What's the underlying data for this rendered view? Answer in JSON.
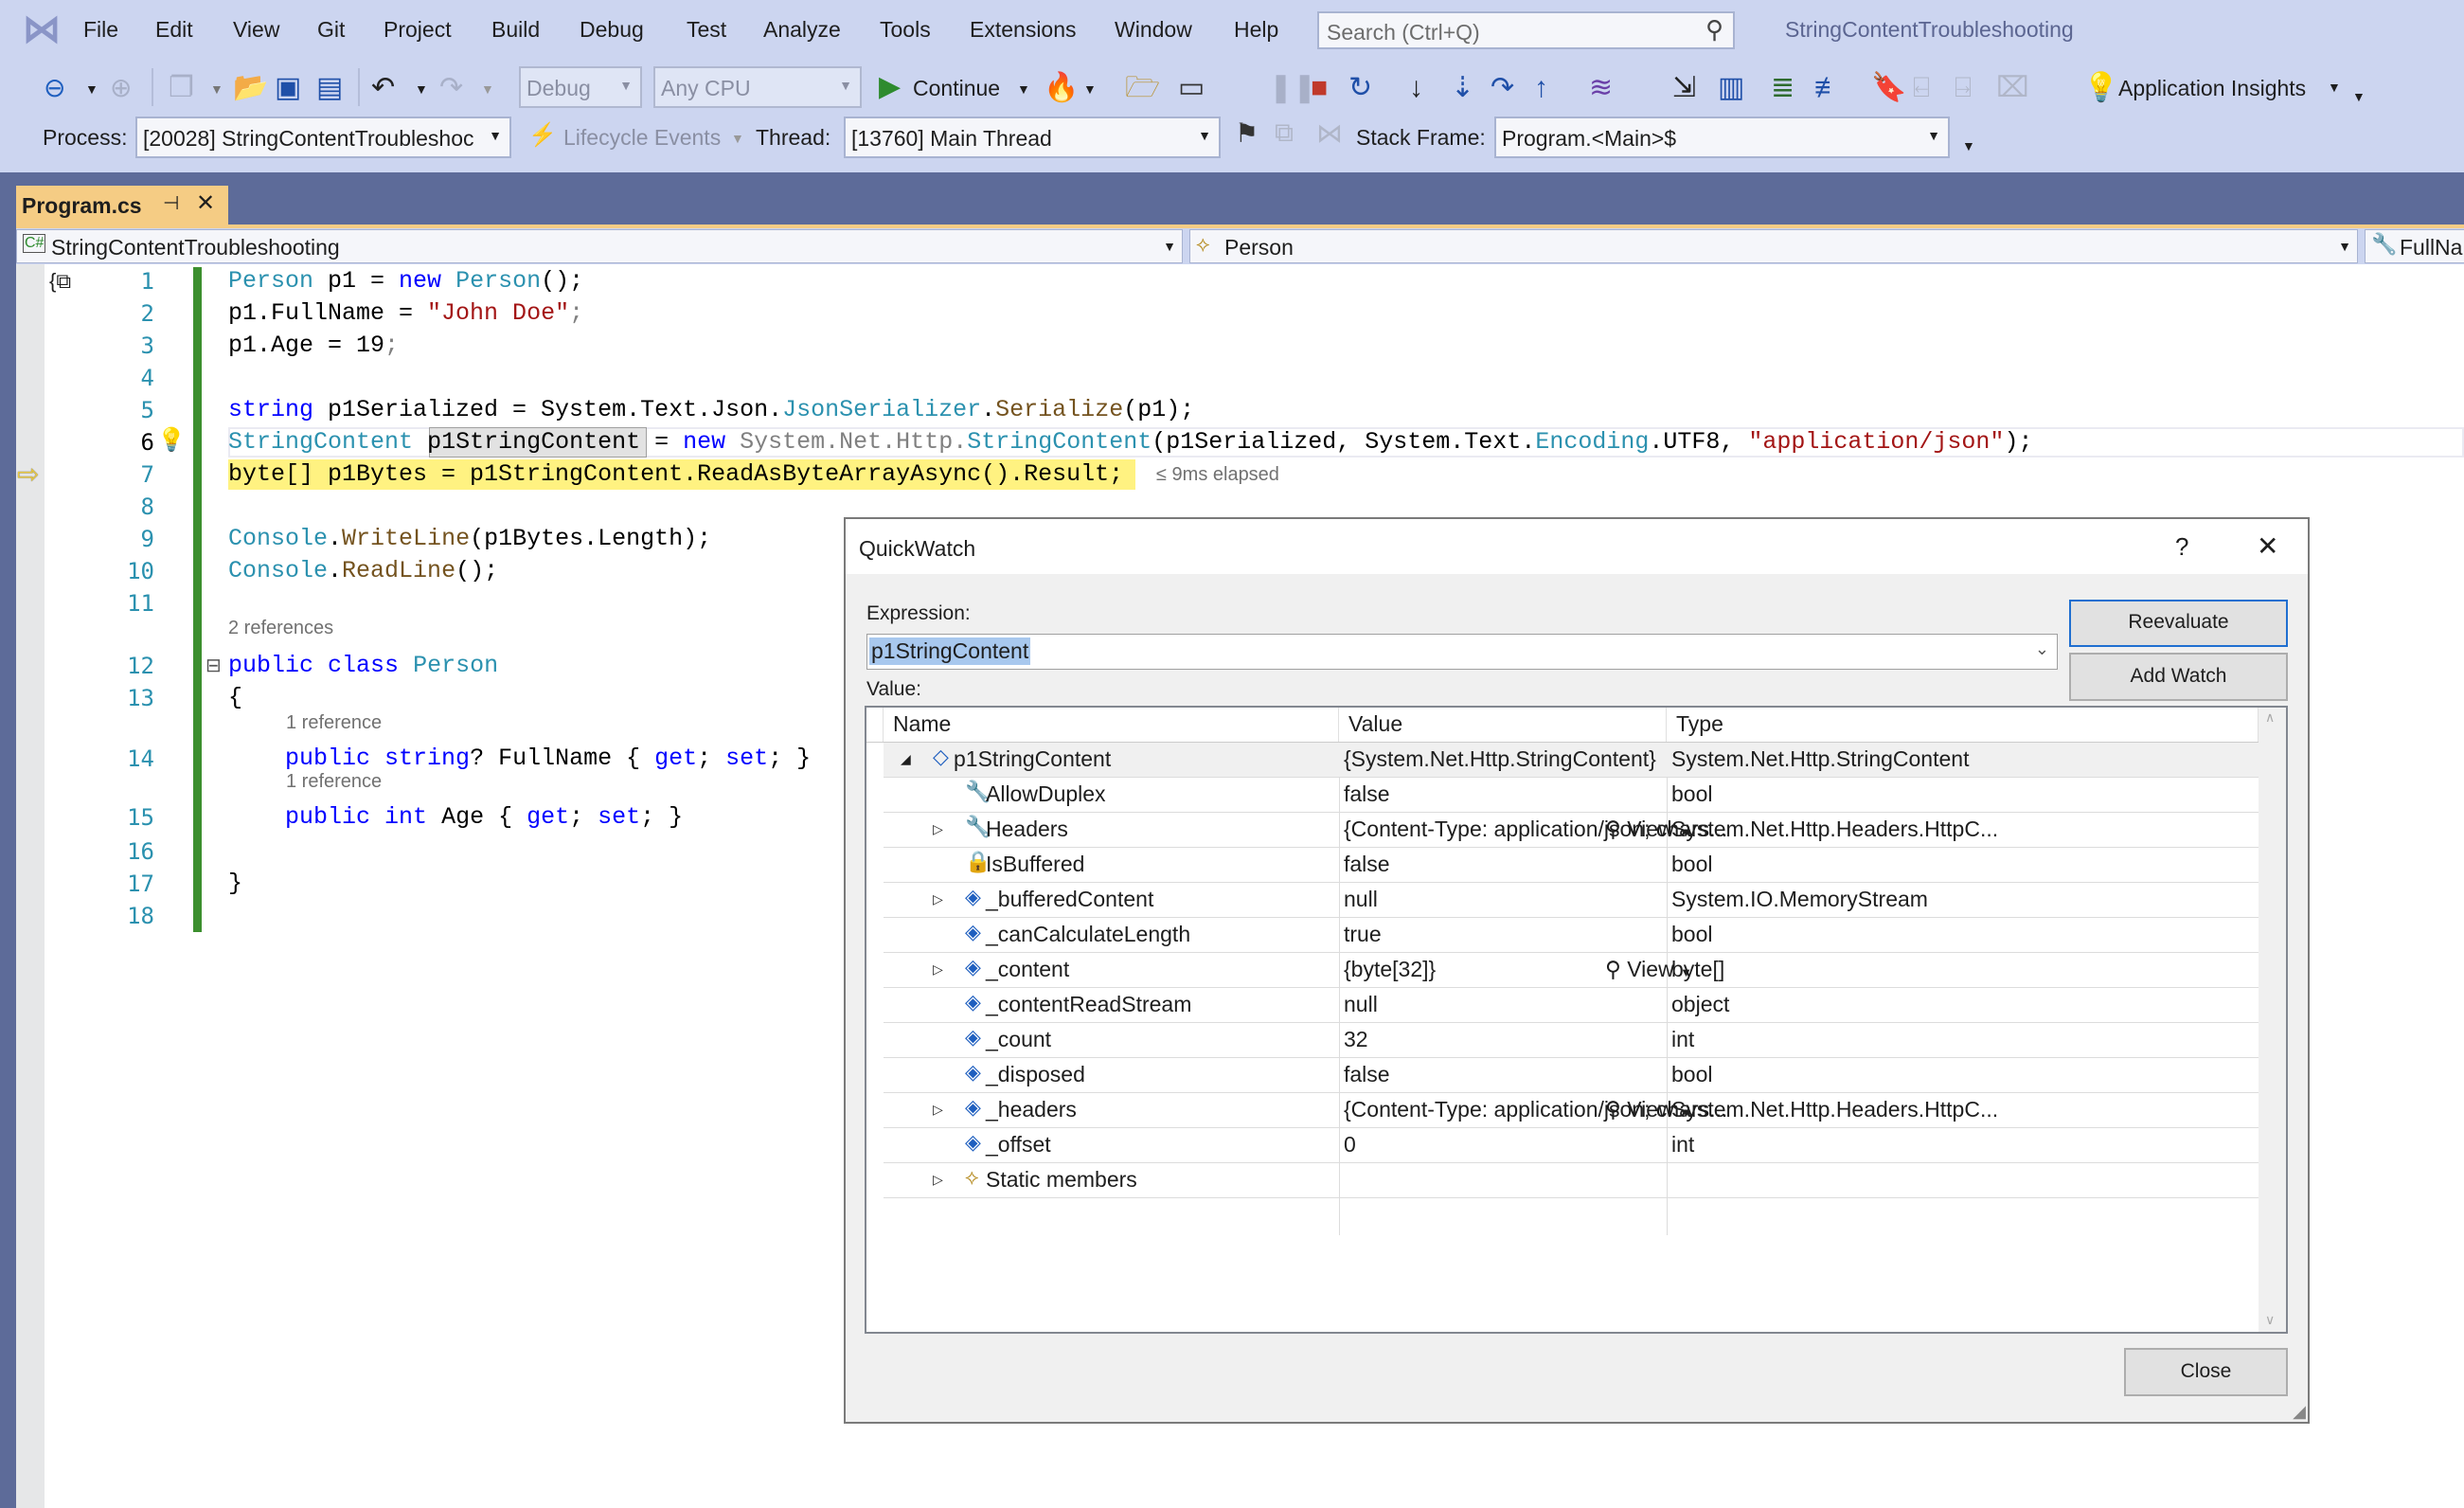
{
  "window": {
    "title": "StringContentTroubleshooting"
  },
  "menu": {
    "items": [
      "File",
      "Edit",
      "View",
      "Git",
      "Project",
      "Build",
      "Debug",
      "Test",
      "Analyze",
      "Tools",
      "Extensions",
      "Window",
      "Help"
    ],
    "search_placeholder": "Search (Ctrl+Q)"
  },
  "toolbar": {
    "config": "Debug",
    "platform": "Any CPU",
    "continue_label": "Continue",
    "app_insights_label": "Application Insights"
  },
  "debugbar": {
    "process_label": "Process:",
    "process_value": "[20028] StringContentTroubleshoc",
    "lifecycle_label": "Lifecycle Events",
    "thread_label": "Thread:",
    "thread_value": "[13760] Main Thread",
    "stackframe_label": "Stack Frame:",
    "stackframe_value": "Program.<Main>$"
  },
  "tab": {
    "label": "Program.cs"
  },
  "navbar": {
    "project": "StringContentTroubleshooting",
    "type": "Person",
    "member": "FullNa"
  },
  "editor": {
    "elapsed": "≤ 9ms elapsed",
    "lines": [
      {
        "n": "1",
        "tokens": [
          [
            "ty",
            "Person"
          ],
          [
            "pl",
            " p1 = "
          ],
          [
            "kw",
            "new"
          ],
          [
            "pl",
            " "
          ],
          [
            "ty",
            "Person"
          ],
          [
            "pl",
            "();"
          ]
        ]
      },
      {
        "n": "2",
        "tokens": [
          [
            "pl",
            "p1.FullName = "
          ],
          [
            "st",
            "\"John Doe\""
          ],
          [
            "gr",
            ";"
          ]
        ]
      },
      {
        "n": "3",
        "tokens": [
          [
            "pl",
            "p1.Age = 19"
          ],
          [
            "gr",
            ";"
          ]
        ]
      },
      {
        "n": "4",
        "tokens": []
      },
      {
        "n": "5",
        "tokens": [
          [
            "kw",
            "string"
          ],
          [
            "pl",
            " p1Serialized = System.Text.Json."
          ],
          [
            "ty",
            "JsonSerializer"
          ],
          [
            "pl",
            "."
          ],
          [
            "me",
            "Serialize"
          ],
          [
            "pl",
            "(p1);"
          ]
        ]
      },
      {
        "n": "6",
        "tokens": [
          [
            "ty",
            "StringContent"
          ],
          [
            "pl",
            " "
          ],
          [
            "pl",
            "p1StringContent"
          ],
          [
            "pl",
            " = "
          ],
          [
            "kw",
            "new"
          ],
          [
            "pl",
            " "
          ],
          [
            "gr",
            "System.Net.Http."
          ],
          [
            "ty",
            "StringContent"
          ],
          [
            "pl",
            "(p1Serialized, System.Text."
          ],
          [
            "ty",
            "Encoding"
          ],
          [
            "pl",
            ".UTF8, "
          ],
          [
            "st",
            "\"application/json\""
          ],
          [
            "pl",
            ");"
          ]
        ]
      },
      {
        "n": "7",
        "tokens": [
          [
            "pl",
            "byte[] p1Bytes = p1StringContent.ReadAsByteArrayAsync().Result;"
          ]
        ]
      },
      {
        "n": "8",
        "tokens": []
      },
      {
        "n": "9",
        "tokens": [
          [
            "ty",
            "Console"
          ],
          [
            "pl",
            "."
          ],
          [
            "me",
            "WriteLine"
          ],
          [
            "pl",
            "(p1Bytes.Length);"
          ]
        ]
      },
      {
        "n": "10",
        "tokens": [
          [
            "ty",
            "Console"
          ],
          [
            "pl",
            "."
          ],
          [
            "me",
            "ReadLine"
          ],
          [
            "pl",
            "();"
          ]
        ]
      },
      {
        "n": "11",
        "tokens": []
      },
      {
        "n": "12",
        "tokens": [
          [
            "kw",
            "public"
          ],
          [
            "pl",
            " "
          ],
          [
            "kw",
            "class"
          ],
          [
            "pl",
            " "
          ],
          [
            "ty",
            "Person"
          ]
        ]
      },
      {
        "n": "13",
        "tokens": [
          [
            "pl",
            "{"
          ]
        ]
      },
      {
        "n": "14",
        "tokens": [
          [
            "pl",
            "    "
          ],
          [
            "kw",
            "public"
          ],
          [
            "pl",
            " "
          ],
          [
            "kw",
            "string"
          ],
          [
            "pl",
            "? FullName { "
          ],
          [
            "kw",
            "get"
          ],
          [
            "pl",
            "; "
          ],
          [
            "kw",
            "set"
          ],
          [
            "pl",
            "; }"
          ]
        ]
      },
      {
        "n": "15",
        "tokens": [
          [
            "pl",
            "    "
          ],
          [
            "kw",
            "public"
          ],
          [
            "pl",
            " "
          ],
          [
            "kw",
            "int"
          ],
          [
            "pl",
            " Age { "
          ],
          [
            "kw",
            "get"
          ],
          [
            "pl",
            "; "
          ],
          [
            "kw",
            "set"
          ],
          [
            "pl",
            "; }"
          ]
        ]
      },
      {
        "n": "16",
        "tokens": []
      },
      {
        "n": "17",
        "tokens": [
          [
            "pl",
            "}"
          ]
        ]
      },
      {
        "n": "18",
        "tokens": []
      }
    ],
    "lens": [
      "2 references",
      "1 reference",
      "1 reference"
    ]
  },
  "quickwatch": {
    "title": "QuickWatch",
    "help": "?",
    "expression_label": "Expression:",
    "expression_value": "p1StringContent",
    "value_label": "Value:",
    "reevaluate_label": "Reevaluate",
    "addwatch_label": "Add Watch",
    "close_label": "Close",
    "view_label": "View",
    "columns": [
      "Name",
      "Value",
      "Type"
    ],
    "rows": [
      {
        "name": "p1StringContent",
        "value": "{System.Net.Http.StringContent}",
        "type": "System.Net.Http.StringContent",
        "level": 0,
        "expander": "expanded",
        "icon": "object-icon"
      },
      {
        "name": "AllowDuplex",
        "value": "false",
        "type": "bool",
        "level": 1,
        "expander": "",
        "icon": "property-icon"
      },
      {
        "name": "Headers",
        "value": "{Content-Type: application/json; chars...",
        "type": "System.Net.Http.Headers.HttpC...",
        "level": 1,
        "expander": "collapsed",
        "icon": "property-icon",
        "view": true
      },
      {
        "name": "IsBuffered",
        "value": "false",
        "type": "bool",
        "level": 1,
        "expander": "",
        "icon": "private-property-icon"
      },
      {
        "name": "_bufferedContent",
        "value": "null",
        "type": "System.IO.MemoryStream",
        "level": 1,
        "expander": "collapsed",
        "icon": "private-field-icon"
      },
      {
        "name": "_canCalculateLength",
        "value": "true",
        "type": "bool",
        "level": 1,
        "expander": "",
        "icon": "private-field-icon"
      },
      {
        "name": "_content",
        "value": "{byte[32]}",
        "type": "byte[]",
        "level": 1,
        "expander": "collapsed",
        "icon": "private-field-icon",
        "view": true
      },
      {
        "name": "_contentReadStream",
        "value": "null",
        "type": "object",
        "level": 1,
        "expander": "",
        "icon": "private-field-icon"
      },
      {
        "name": "_count",
        "value": "32",
        "type": "int",
        "level": 1,
        "expander": "",
        "icon": "private-field-icon"
      },
      {
        "name": "_disposed",
        "value": "false",
        "type": "bool",
        "level": 1,
        "expander": "",
        "icon": "private-field-icon"
      },
      {
        "name": "_headers",
        "value": "{Content-Type: application/json; chars...",
        "type": "System.Net.Http.Headers.HttpC...",
        "level": 1,
        "expander": "collapsed",
        "icon": "private-field-icon",
        "view": true
      },
      {
        "name": "_offset",
        "value": "0",
        "type": "int",
        "level": 1,
        "expander": "",
        "icon": "private-field-icon"
      },
      {
        "name": "Static members",
        "value": "",
        "type": "",
        "level": 1,
        "expander": "collapsed",
        "icon": "static-members-icon"
      }
    ]
  },
  "colors": {
    "chrome": "#ccd5f0",
    "band": "#5d6b99",
    "tab": "#f5cc84",
    "current_line": "#fff281",
    "keyword": "#0000ff",
    "type": "#2b91af",
    "string": "#a31515"
  }
}
